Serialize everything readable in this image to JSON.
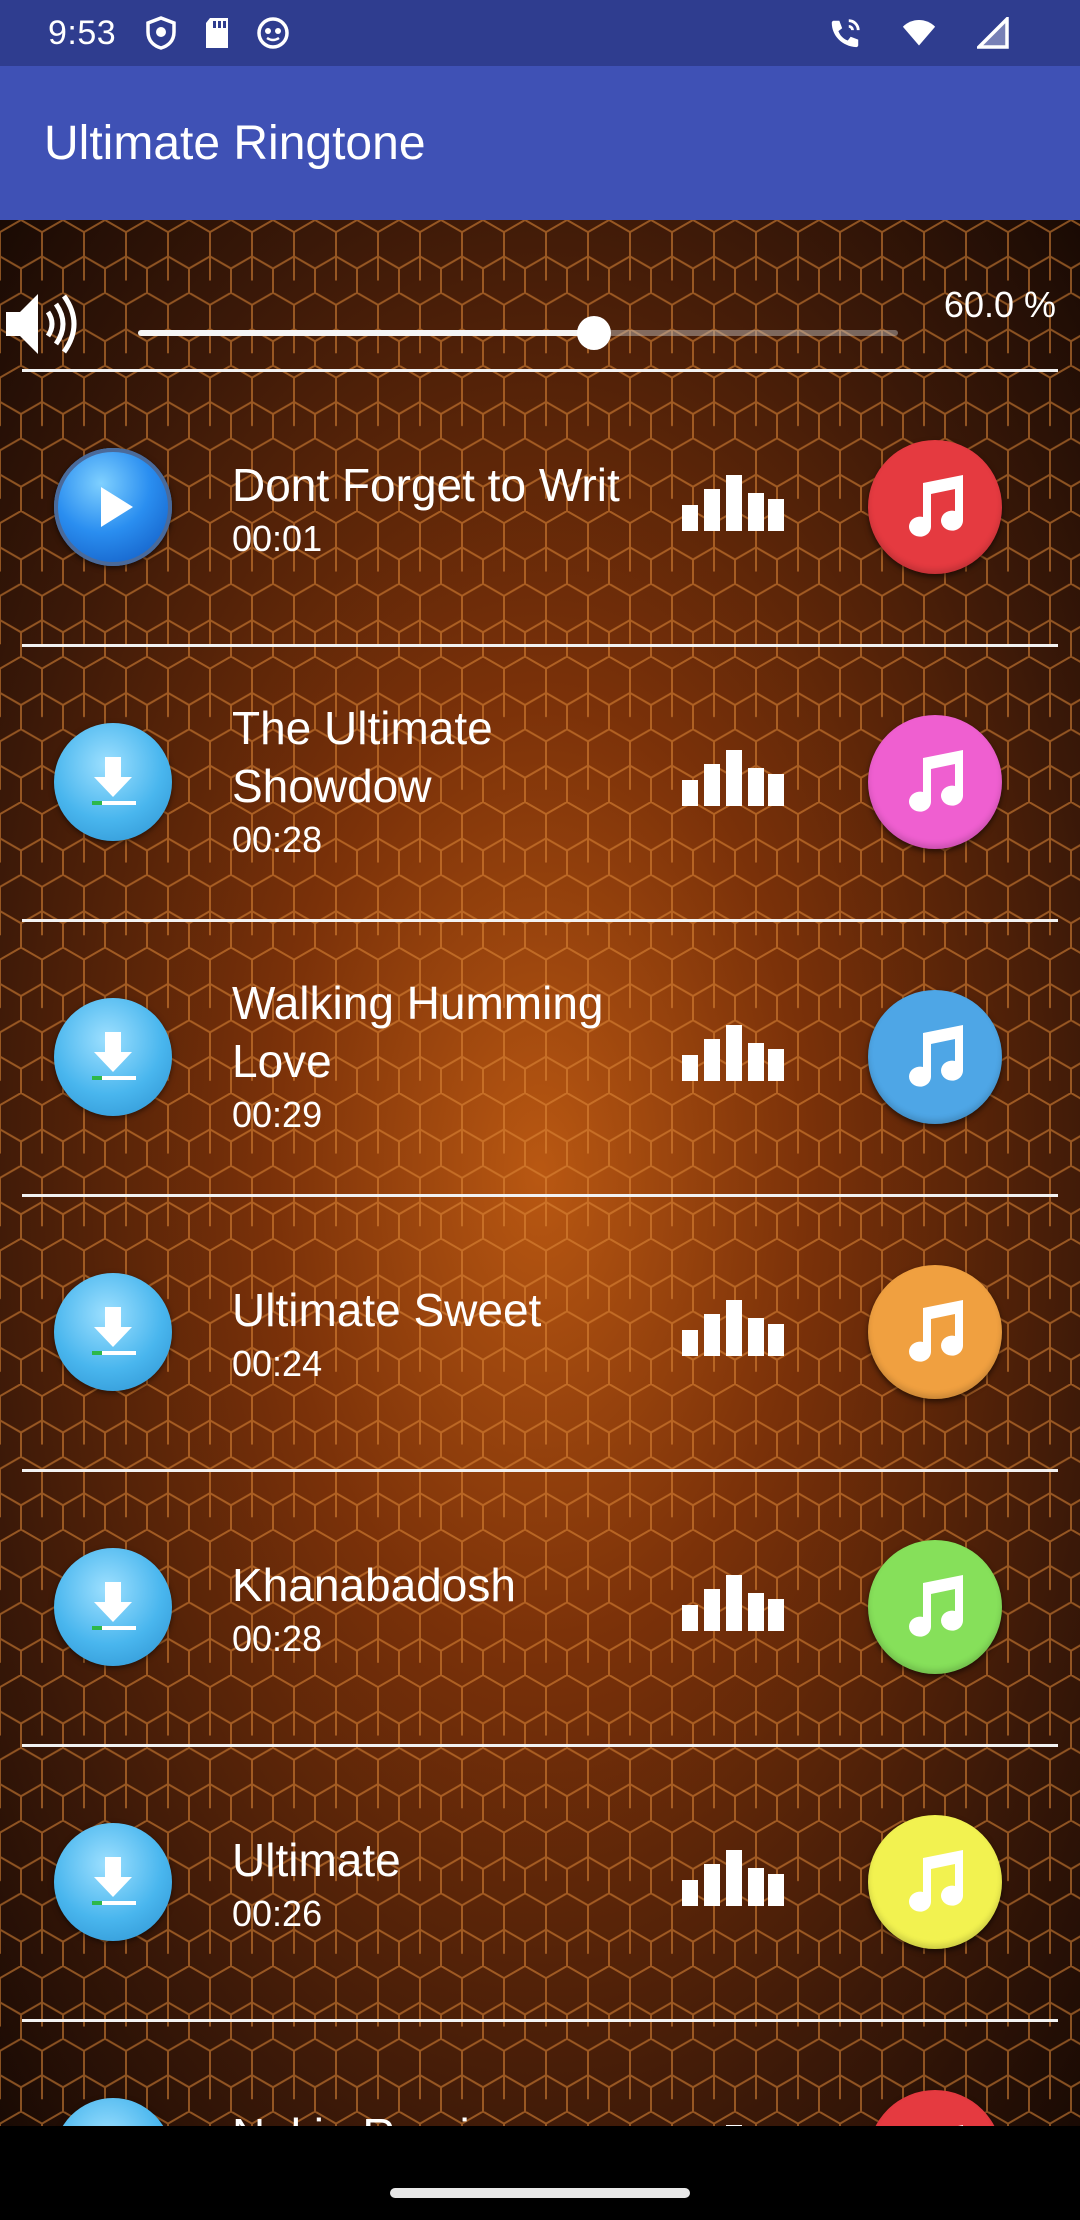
{
  "status_bar": {
    "time": "9:53"
  },
  "app_bar": {
    "title": "Ultimate Ringtone"
  },
  "volume": {
    "level": 0.6,
    "label": "60.0 %"
  },
  "songs": [
    {
      "title": "Dont Forget to Writ",
      "duration": "00:01",
      "state": "playing",
      "note_color": "#e53a40"
    },
    {
      "title": "The Ultimate Showdow",
      "duration": "00:28",
      "state": "download",
      "note_color": "#ef5fd0"
    },
    {
      "title": "Walking Humming Love",
      "duration": "00:29",
      "state": "download",
      "note_color": "#4ea6e6"
    },
    {
      "title": "Ultimate Sweet",
      "duration": "00:24",
      "state": "download",
      "note_color": "#f0a040"
    },
    {
      "title": "Khanabadosh",
      "duration": "00:28",
      "state": "download",
      "note_color": "#86e05a"
    },
    {
      "title": "Ultimate",
      "duration": "00:26",
      "state": "download",
      "note_color": "#f2f250"
    },
    {
      "title": "Nokia Remix",
      "duration": "",
      "state": "download",
      "note_color": "#e53a40"
    }
  ],
  "colors": {
    "status_bar": "#2f3d8f",
    "app_bar": "#3f51b5"
  },
  "icons": {
    "status": [
      "shield-icon",
      "sd-card-icon",
      "app-notification-icon"
    ],
    "status_right": [
      "wifi-calling-icon",
      "wifi-icon",
      "signal-icon"
    ],
    "volume": "speaker-icon",
    "row": [
      "play-icon",
      "download-icon",
      "equalizer-icon",
      "music-note-icon"
    ]
  }
}
